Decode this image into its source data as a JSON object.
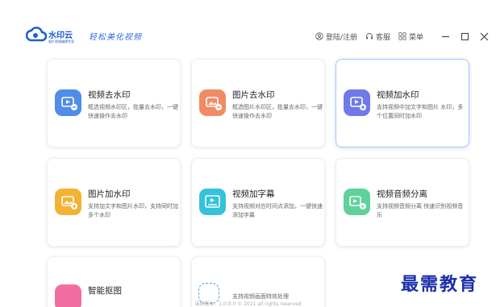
{
  "brand": {
    "name": "水印云",
    "sub": "图片视频编辑专家",
    "slogan": "轻松美化视频"
  },
  "header": {
    "login_label": "登陆/注册",
    "service_label": "客服",
    "menu_label": "菜单"
  },
  "cards": [
    {
      "title": "视频去水印",
      "desc": "框选视频水印区，批量去水印，一键快速操作去水印",
      "color": "#4f8de8"
    },
    {
      "title": "图片去水印",
      "desc": "框选图片水印区，批量去水印，一键快速操作去水印",
      "color": "#f08b63"
    },
    {
      "title": "视频加水印",
      "desc": "支持视频中加文字和图片 水印，多个位置同时加水印",
      "color": "#6f79ea"
    },
    {
      "title": "图片加水印",
      "desc": "支持加文字和图片水印，支持同时加多个水印",
      "color": "#f3b233"
    },
    {
      "title": "视频加字幕",
      "desc": "支持视频对应时间点添加，一键快速添加字幕",
      "color": "#35c3da"
    },
    {
      "title": "视频音频分离",
      "desc": "支持视频音频分离 快速识别视频音乐",
      "color": "#5fd19a"
    },
    {
      "title": "智能抠图",
      "desc": "",
      "color": "#f06fa0"
    },
    {
      "title": "支持视频画面特效处理",
      "desc": "",
      "color": "#5a9ee8"
    }
  ],
  "watermark": "最需教育",
  "footer": "当前版本：1.0.0.0 © 2021 all rights reserved"
}
